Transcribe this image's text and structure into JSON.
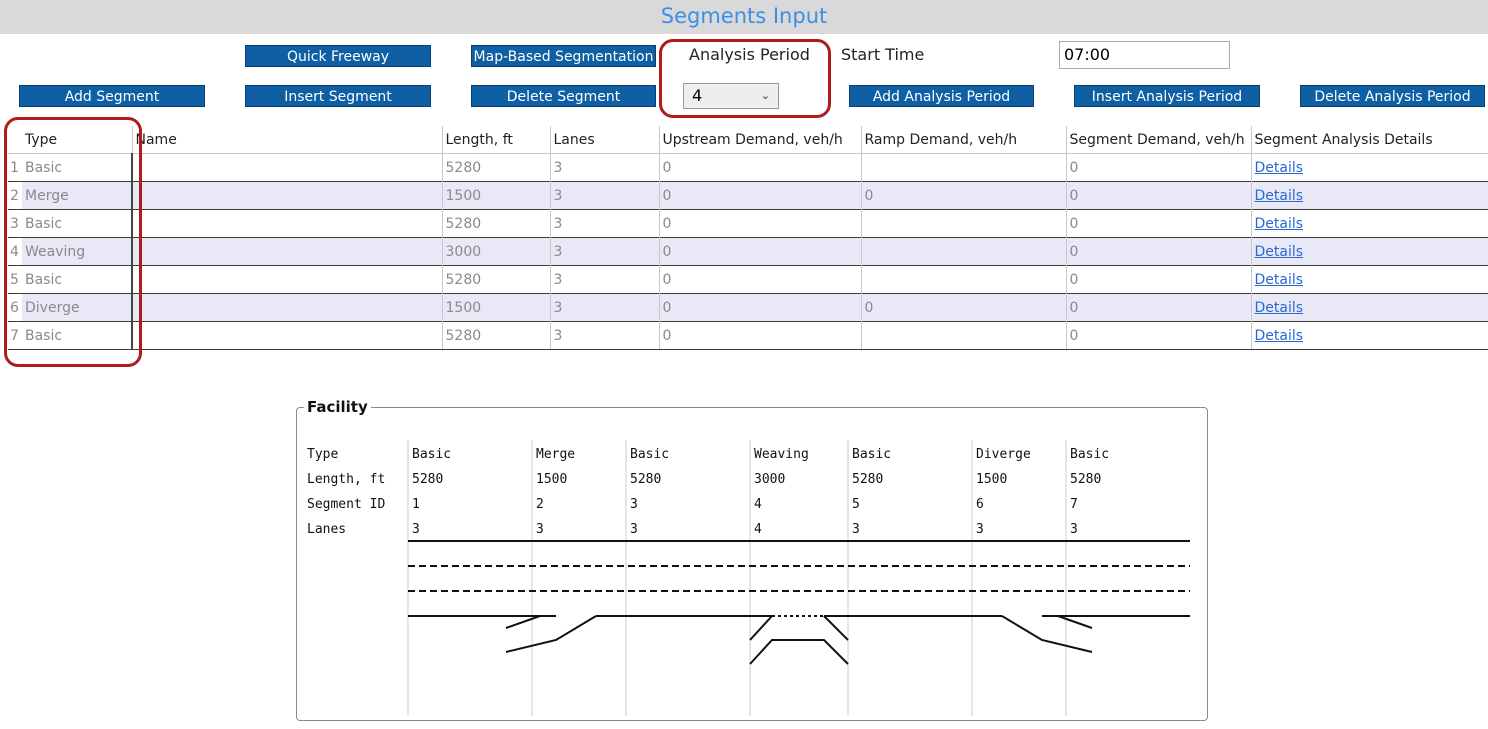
{
  "window": {
    "title": "Segments Input"
  },
  "toolbar": {
    "quick_freeway": "Quick Freeway",
    "map_based": "Map-Based Segmentation",
    "add_segment": "Add Segment",
    "insert_segment": "Insert Segment",
    "delete_segment": "Delete Segment",
    "add_period": "Add Analysis Period",
    "insert_period": "Insert Analysis Period",
    "delete_period": "Delete Analysis Period"
  },
  "analysis_period": {
    "label": "Analysis Period",
    "value": "4"
  },
  "start_time": {
    "label": "Start Time",
    "value": "07:00"
  },
  "table": {
    "headers": [
      "Type",
      "Name",
      "Length, ft",
      "Lanes",
      "Upstream Demand, veh/h",
      "Ramp Demand, veh/h",
      "Segment Demand, veh/h",
      "Segment Analysis Details"
    ],
    "rows": [
      {
        "idx": "1",
        "type": "Basic",
        "name": "",
        "length": "5280",
        "lanes": "3",
        "upstream": "0",
        "ramp": "",
        "segment": "0",
        "details": "Details"
      },
      {
        "idx": "2",
        "type": "Merge",
        "name": "",
        "length": "1500",
        "lanes": "3",
        "upstream": "0",
        "ramp": "0",
        "segment": "0",
        "details": "Details"
      },
      {
        "idx": "3",
        "type": "Basic",
        "name": "",
        "length": "5280",
        "lanes": "3",
        "upstream": "0",
        "ramp": "",
        "segment": "0",
        "details": "Details"
      },
      {
        "idx": "4",
        "type": "Weaving",
        "name": "",
        "length": "3000",
        "lanes": "3",
        "upstream": "0",
        "ramp": "",
        "segment": "0",
        "details": "Details"
      },
      {
        "idx": "5",
        "type": "Basic",
        "name": "",
        "length": "5280",
        "lanes": "3",
        "upstream": "0",
        "ramp": "",
        "segment": "0",
        "details": "Details"
      },
      {
        "idx": "6",
        "type": "Diverge",
        "name": "",
        "length": "1500",
        "lanes": "3",
        "upstream": "0",
        "ramp": "0",
        "segment": "0",
        "details": "Details"
      },
      {
        "idx": "7",
        "type": "Basic",
        "name": "",
        "length": "5280",
        "lanes": "3",
        "upstream": "0",
        "ramp": "",
        "segment": "0",
        "details": "Details"
      }
    ]
  },
  "facility": {
    "title": "Facility",
    "row_labels": [
      "Type",
      "Length, ft",
      "Segment ID",
      "Lanes"
    ],
    "segments": [
      {
        "type": "Basic",
        "length": "5280",
        "id": "1",
        "lanes": "3"
      },
      {
        "type": "Merge",
        "length": "1500",
        "id": "2",
        "lanes": "3"
      },
      {
        "type": "Basic",
        "length": "5280",
        "id": "3",
        "lanes": "3"
      },
      {
        "type": "Weaving",
        "length": "3000",
        "id": "4",
        "lanes": "4"
      },
      {
        "type": "Basic",
        "length": "5280",
        "id": "5",
        "lanes": "3"
      },
      {
        "type": "Diverge",
        "length": "1500",
        "id": "6",
        "lanes": "3"
      },
      {
        "type": "Basic",
        "length": "5280",
        "id": "7",
        "lanes": "3"
      }
    ]
  },
  "colors": {
    "button": "#0e5fa3",
    "highlight": "#b01c1c",
    "alt_row": "#e8e8f7",
    "link": "#2a6ad2",
    "title_text": "#3d8ee8"
  }
}
